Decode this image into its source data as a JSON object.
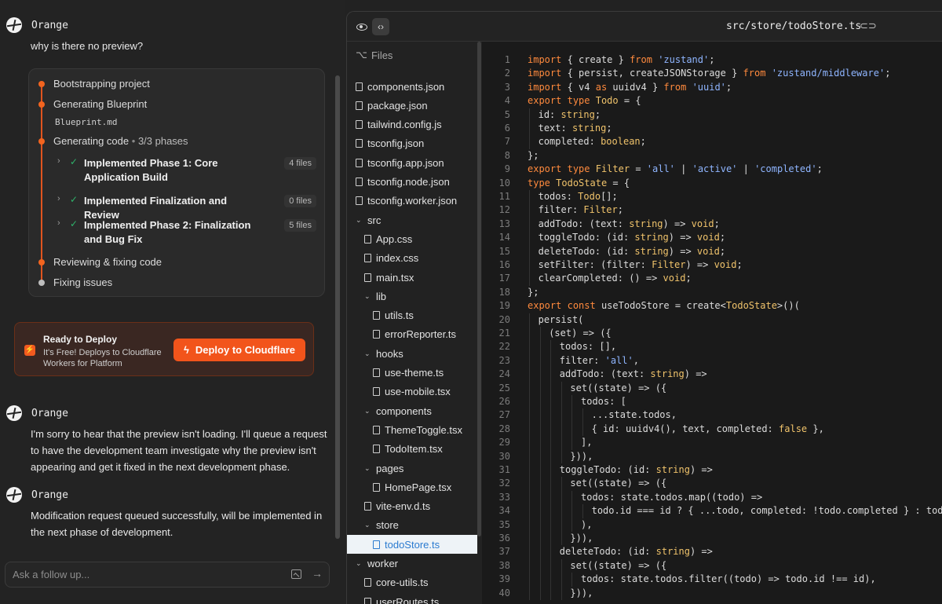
{
  "chat": {
    "messages": [
      {
        "author": "Orange",
        "text": "why is there no preview?"
      },
      {
        "author": "Orange",
        "text": "I'm sorry to hear that the preview isn't loading. I'll queue a request to have the development team investigate why the preview isn't appearing and get it fixed in the next development phase."
      },
      {
        "author": "Orange",
        "text": "Modification request queued successfully, will be implemented in the next phase of development."
      }
    ],
    "progress": {
      "steps": [
        "Bootstrapping project",
        "Generating Blueprint",
        "Generating code",
        "Reviewing & fixing code",
        "Fixing issues"
      ],
      "blueprint_file": "Blueprint.md",
      "phase_separator": "•",
      "phase_count": "3/3 phases",
      "phases": [
        {
          "title": "Implemented Phase 1: Core Application Build",
          "files": "4 files"
        },
        {
          "title": "Implemented Finalization and Review",
          "files": "0 files"
        },
        {
          "title": "Implemented Phase 2: Finalization and Bug Fix",
          "files": "5 files"
        }
      ]
    },
    "deploy": {
      "title": "Ready to Deploy",
      "subtitle": "It's Free! Deploys to Cloudflare Workers for Platform",
      "button": "Deploy to Cloudflare"
    },
    "input": {
      "placeholder": "Ask a follow up..."
    }
  },
  "editor": {
    "file_path": "src/store/todoStore.ts",
    "tree_header": "Files",
    "files": [
      {
        "name": "components.json",
        "type": "file",
        "depth": 0
      },
      {
        "name": "package.json",
        "type": "file",
        "depth": 0
      },
      {
        "name": "tailwind.config.js",
        "type": "file",
        "depth": 0
      },
      {
        "name": "tsconfig.json",
        "type": "file",
        "depth": 0
      },
      {
        "name": "tsconfig.app.json",
        "type": "file",
        "depth": 0
      },
      {
        "name": "tsconfig.node.json",
        "type": "file",
        "depth": 0
      },
      {
        "name": "tsconfig.worker.json",
        "type": "file",
        "depth": 0
      },
      {
        "name": "src",
        "type": "folder",
        "depth": 0
      },
      {
        "name": "App.css",
        "type": "file",
        "depth": 1
      },
      {
        "name": "index.css",
        "type": "file",
        "depth": 1
      },
      {
        "name": "main.tsx",
        "type": "file",
        "depth": 1
      },
      {
        "name": "lib",
        "type": "folder",
        "depth": 1
      },
      {
        "name": "utils.ts",
        "type": "file",
        "depth": 2
      },
      {
        "name": "errorReporter.ts",
        "type": "file",
        "depth": 2
      },
      {
        "name": "hooks",
        "type": "folder",
        "depth": 1
      },
      {
        "name": "use-theme.ts",
        "type": "file",
        "depth": 2
      },
      {
        "name": "use-mobile.tsx",
        "type": "file",
        "depth": 2
      },
      {
        "name": "components",
        "type": "folder",
        "depth": 1
      },
      {
        "name": "ThemeToggle.tsx",
        "type": "file",
        "depth": 2
      },
      {
        "name": "TodoItem.tsx",
        "type": "file",
        "depth": 2
      },
      {
        "name": "pages",
        "type": "folder",
        "depth": 1
      },
      {
        "name": "HomePage.tsx",
        "type": "file",
        "depth": 2
      },
      {
        "name": "vite-env.d.ts",
        "type": "file",
        "depth": 1
      },
      {
        "name": "store",
        "type": "folder",
        "depth": 1
      },
      {
        "name": "todoStore.ts",
        "type": "file",
        "depth": 2,
        "selected": true
      },
      {
        "name": "worker",
        "type": "folder",
        "depth": 0
      },
      {
        "name": "core-utils.ts",
        "type": "file",
        "depth": 1
      },
      {
        "name": "userRoutes.ts",
        "type": "file",
        "depth": 1
      }
    ],
    "code": [
      {
        "n": "1",
        "indent": 0,
        "text": "import { create } from 'zustand';"
      },
      {
        "n": "2",
        "indent": 0,
        "text": "import { persist, createJSONStorage } from 'zustand/middleware';"
      },
      {
        "n": "3",
        "indent": 0,
        "text": "import { v4 as uuidv4 } from 'uuid';"
      },
      {
        "n": "4",
        "indent": 0,
        "text": "export type Todo = {"
      },
      {
        "n": "5",
        "indent": 1,
        "text": "id: string;"
      },
      {
        "n": "6",
        "indent": 1,
        "text": "text: string;"
      },
      {
        "n": "7",
        "indent": 1,
        "text": "completed: boolean;"
      },
      {
        "n": "8",
        "indent": 0,
        "text": "};"
      },
      {
        "n": "9",
        "indent": 0,
        "text": "export type Filter = 'all' | 'active' | 'completed';"
      },
      {
        "n": "10",
        "indent": 0,
        "text": "type TodoState = {"
      },
      {
        "n": "11",
        "indent": 1,
        "text": "todos: Todo[];"
      },
      {
        "n": "12",
        "indent": 1,
        "text": "filter: Filter;"
      },
      {
        "n": "13",
        "indent": 1,
        "text": "addTodo: (text: string) => void;"
      },
      {
        "n": "14",
        "indent": 1,
        "text": "toggleTodo: (id: string) => void;"
      },
      {
        "n": "15",
        "indent": 1,
        "text": "deleteTodo: (id: string) => void;"
      },
      {
        "n": "16",
        "indent": 1,
        "text": "setFilter: (filter: Filter) => void;"
      },
      {
        "n": "17",
        "indent": 1,
        "text": "clearCompleted: () => void;"
      },
      {
        "n": "18",
        "indent": 0,
        "text": "};"
      },
      {
        "n": "19",
        "indent": 0,
        "text": "export const useTodoStore = create<TodoState>()("
      },
      {
        "n": "20",
        "indent": 1,
        "text": "persist("
      },
      {
        "n": "21",
        "indent": 2,
        "text": "(set) => ({"
      },
      {
        "n": "22",
        "indent": 3,
        "text": "todos: [],"
      },
      {
        "n": "23",
        "indent": 3,
        "text": "filter: 'all',"
      },
      {
        "n": "24",
        "indent": 3,
        "text": "addTodo: (text: string) =>"
      },
      {
        "n": "25",
        "indent": 4,
        "text": "set((state) => ({"
      },
      {
        "n": "26",
        "indent": 5,
        "text": "todos: ["
      },
      {
        "n": "27",
        "indent": 6,
        "text": "...state.todos,"
      },
      {
        "n": "28",
        "indent": 6,
        "text": "{ id: uuidv4(), text, completed: false },"
      },
      {
        "n": "29",
        "indent": 5,
        "text": "],"
      },
      {
        "n": "30",
        "indent": 4,
        "text": "})),"
      },
      {
        "n": "31",
        "indent": 3,
        "text": "toggleTodo: (id: string) =>"
      },
      {
        "n": "32",
        "indent": 4,
        "text": "set((state) => ({"
      },
      {
        "n": "33",
        "indent": 5,
        "text": "todos: state.todos.map((todo) =>"
      },
      {
        "n": "34",
        "indent": 6,
        "text": "todo.id === id ? { ...todo, completed: !todo.completed } : todo"
      },
      {
        "n": "35",
        "indent": 5,
        "text": "),"
      },
      {
        "n": "36",
        "indent": 4,
        "text": "})),"
      },
      {
        "n": "37",
        "indent": 3,
        "text": "deleteTodo: (id: string) =>"
      },
      {
        "n": "38",
        "indent": 4,
        "text": "set((state) => ({"
      },
      {
        "n": "39",
        "indent": 5,
        "text": "todos: state.todos.filter((todo) => todo.id !== id),"
      },
      {
        "n": "40",
        "indent": 4,
        "text": "})),"
      }
    ]
  },
  "colors": {
    "accent": "#f2541b",
    "keyword": "#ff8a3d",
    "string": "#8fb5ff",
    "type": "#f0c36b",
    "success": "#2fb36b"
  }
}
